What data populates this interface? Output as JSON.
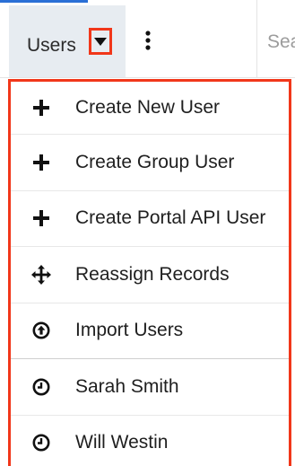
{
  "navbar": {
    "module_label": "Users",
    "caret_icon": "caret-down-icon",
    "more_icon": "kebab-icon",
    "search": {
      "value": "",
      "placeholder": "Search"
    }
  },
  "dropdown": {
    "actions": [
      {
        "label": "Create New User",
        "icon": "plus-icon"
      },
      {
        "label": "Create Group User",
        "icon": "plus-icon"
      },
      {
        "label": "Create Portal API User",
        "icon": "plus-icon"
      },
      {
        "label": "Reassign Records",
        "icon": "move-arrows-icon"
      },
      {
        "label": "Import Users",
        "icon": "upload-circle-icon"
      }
    ],
    "recently_viewed": [
      {
        "label": "Sarah Smith",
        "icon": "clock-icon"
      },
      {
        "label": "Will Westin",
        "icon": "clock-icon"
      }
    ]
  },
  "colors": {
    "highlight": "#f1371a",
    "tab_background": "#e7ecf1",
    "accent": "#2a6fd6"
  }
}
